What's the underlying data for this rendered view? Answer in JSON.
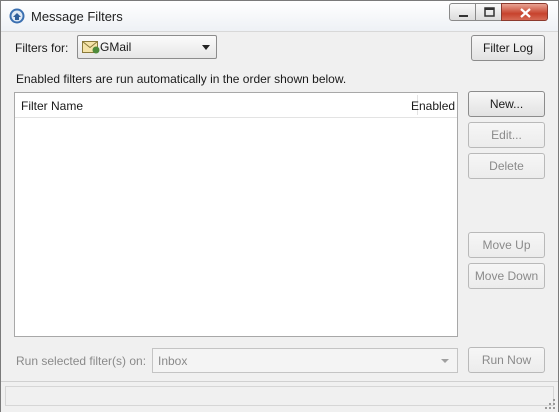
{
  "window": {
    "title": "Message Filters",
    "icon": "thunderbird-icon",
    "controls": [
      "minimize-icon",
      "maximize-icon",
      "close-icon"
    ],
    "close_color": "#c7432d"
  },
  "filters_for": {
    "label": "Filters for:",
    "selected_account": "GMail",
    "account_icon": "mail-account-icon"
  },
  "buttons": {
    "filter_log": "Filter Log",
    "new": "New...",
    "edit": "Edit...",
    "delete": "Delete",
    "move_up": "Move Up",
    "move_down": "Move Down",
    "run_now": "Run Now"
  },
  "hint": "Enabled filters are run automatically in the order shown below.",
  "filter_list": {
    "columns": [
      "Filter Name",
      "Enabled"
    ],
    "rows": []
  },
  "run_selected": {
    "label": "Run selected filter(s) on:",
    "folder": "Inbox"
  }
}
